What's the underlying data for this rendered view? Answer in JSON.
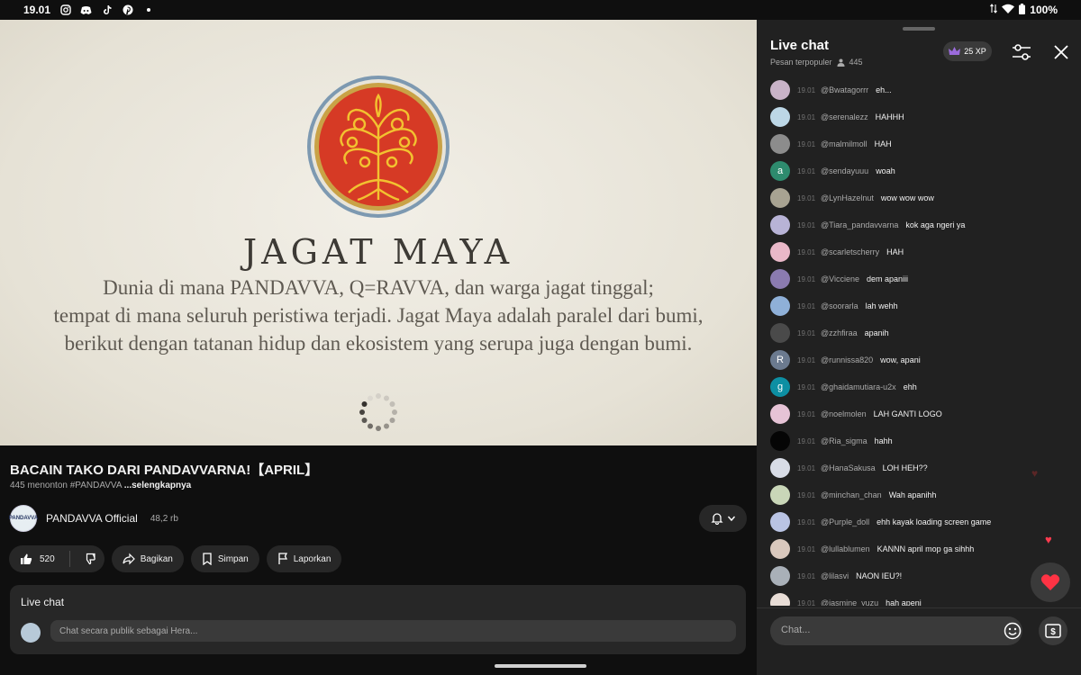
{
  "status_bar": {
    "time": "19.01",
    "battery": "100%",
    "app_icons": [
      "instagram-icon",
      "discord-icon",
      "tiktok-icon",
      "pinterest-icon"
    ]
  },
  "video": {
    "title_text": "JAGAT MAYA",
    "description_lines": [
      "Dunia di mana PANDAVVA, Q=RAVVA, dan warga jagat tinggal;",
      "tempat di mana seluruh peristiwa terjadi. Jagat Maya adalah paralel dari bumi,",
      "berikut dengan tatanan hidup dan ekosistem yang serupa juga dengan bumi."
    ],
    "buffering": true
  },
  "info": {
    "title": "BACAIN TAKO DARI PANDAVVARNA!【APRIL】",
    "viewers": "445 menonton",
    "hashtag": "#PANDAVVA",
    "more": "...selengkapnya",
    "channel_name": "PANDAVVA Official",
    "channel_logo_text": "PANDAVVA",
    "subscribers": "48,2 rb"
  },
  "actions": {
    "like_count": "520",
    "share": "Bagikan",
    "save": "Simpan",
    "report": "Laporkan"
  },
  "livebox": {
    "title": "Live chat",
    "placeholder": "Chat secara publik sebagai Hera..."
  },
  "chat": {
    "title": "Live chat",
    "mode": "Pesan terpopuler",
    "viewer_count": "445",
    "xp": "25 XP",
    "input_placeholder": "Chat...",
    "messages": [
      {
        "time": "19.01",
        "user": "@Bwatagorrr",
        "text": "eh...",
        "avatar_color": "#c9b3c8",
        "letter": ""
      },
      {
        "time": "19.01",
        "user": "@serenalezz",
        "text": "HAHHH",
        "avatar_color": "#bcd7e6",
        "letter": ""
      },
      {
        "time": "19.01",
        "user": "@malmilmoll",
        "text": "HAH",
        "avatar_color": "#8c8c8c",
        "letter": ""
      },
      {
        "time": "19.01",
        "user": "@sendayuuu",
        "text": "woah",
        "avatar_color": "#2e8b6e",
        "letter": "a"
      },
      {
        "time": "19.01",
        "user": "@LynHazelnut",
        "text": "wow wow wow",
        "avatar_color": "#a8a392",
        "letter": ""
      },
      {
        "time": "19.01",
        "user": "@Tiara_pandavvarna",
        "text": "kok aga ngeri ya",
        "avatar_color": "#b8b3d6",
        "letter": ""
      },
      {
        "time": "19.01",
        "user": "@scarletscherry",
        "text": "HAH",
        "avatar_color": "#e9b8c8",
        "letter": ""
      },
      {
        "time": "19.01",
        "user": "@Vicciene",
        "text": "dem apaniii",
        "avatar_color": "#8b7bb0",
        "letter": ""
      },
      {
        "time": "19.01",
        "user": "@soorarla",
        "text": "lah wehh",
        "avatar_color": "#8fb0d8",
        "letter": ""
      },
      {
        "time": "19.01",
        "user": "@zzhfiraa",
        "text": "apanih",
        "avatar_color": "#4a4a4a",
        "letter": ""
      },
      {
        "time": "19.01",
        "user": "@runnissa820",
        "text": "wow, apani",
        "avatar_color": "#6b7a8f",
        "letter": "R"
      },
      {
        "time": "19.01",
        "user": "@ghaidamutiara-u2x",
        "text": "ehh",
        "avatar_color": "#0d8fa3",
        "letter": "g"
      },
      {
        "time": "19.01",
        "user": "@noelmolen",
        "text": "LAH GANTI LOGO",
        "avatar_color": "#e6c3d6",
        "letter": ""
      },
      {
        "time": "19.01",
        "user": "@Ria_sigma",
        "text": "hahh",
        "avatar_color": "#050505",
        "letter": ""
      },
      {
        "time": "19.01",
        "user": "@HanaSakusa",
        "text": "LOH HEH??",
        "avatar_color": "#d8dce6",
        "letter": ""
      },
      {
        "time": "19.01",
        "user": "@minchan_chan",
        "text": "Wah apanihh",
        "avatar_color": "#c9d6b8",
        "letter": ""
      },
      {
        "time": "19.01",
        "user": "@Purple_doll",
        "text": "ehh kayak loading screen game",
        "avatar_color": "#b9c3e3",
        "letter": ""
      },
      {
        "time": "19.01",
        "user": "@lullablumen",
        "text": "KANNN april mop ga sihhh",
        "avatar_color": "#d9c8bd",
        "letter": ""
      },
      {
        "time": "19.01",
        "user": "@lilasvi",
        "text": "NAON IEU?!",
        "avatar_color": "#a9b0b8",
        "letter": ""
      },
      {
        "time": "19.01",
        "user": "@jasmine_yuzu",
        "text": "hah apeni",
        "avatar_color": "#e8ddd6",
        "letter": ""
      }
    ]
  }
}
